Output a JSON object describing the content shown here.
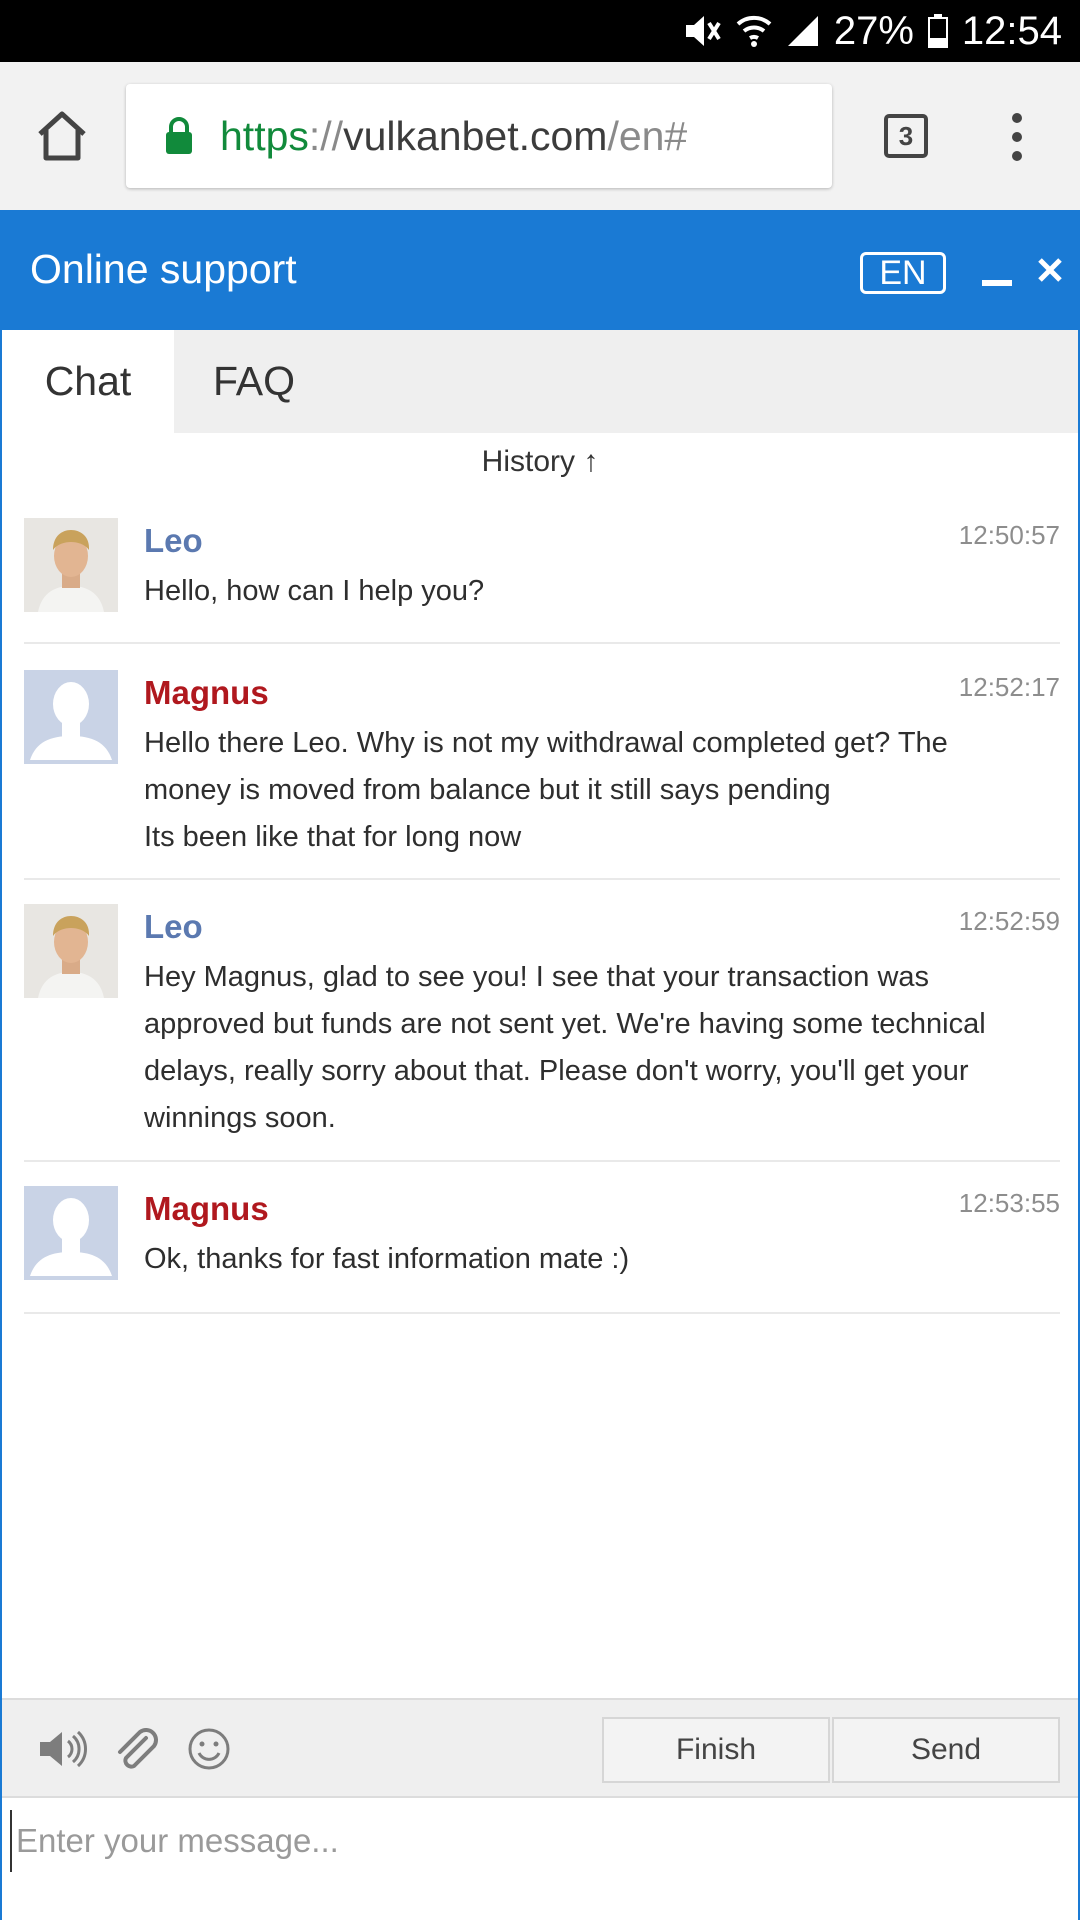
{
  "status_bar": {
    "battery": "27%",
    "time": "12:54"
  },
  "browser": {
    "url_scheme": "https",
    "url_sep": "://",
    "url_host": "vulkanbet.com",
    "url_path": "/en#",
    "tab_count": "3"
  },
  "widget": {
    "title": "Online support",
    "language": "EN",
    "tabs": [
      "Chat",
      "FAQ"
    ],
    "history_label": "History ↑",
    "messages": [
      {
        "sender": "Leo",
        "role": "agent",
        "time": "12:50:57",
        "text": "Hello, how can I help you?"
      },
      {
        "sender": "Magnus",
        "role": "user",
        "time": "12:52:17",
        "text": "Hello there Leo. Why is not my withdrawal completed get? The money is moved from balance but it still says pending\nIts been like that for long now"
      },
      {
        "sender": "Leo",
        "role": "agent",
        "time": "12:52:59",
        "text": "Hey Magnus, glad to see you! I see that your transaction was approved but funds are not sent yet. We're having some technical delays, really sorry about that. Please don't worry, you'll get your winnings soon."
      },
      {
        "sender": "Magnus",
        "role": "user",
        "time": "12:53:55",
        "text": "Ok, thanks for fast information mate :)"
      }
    ],
    "finish_label": "Finish",
    "send_label": "Send",
    "input_placeholder": "Enter your message..."
  },
  "colors": {
    "accent": "#1a7ad4",
    "agent_name": "#5b79b0",
    "user_name": "#b0181e",
    "secure_green": "#118a3b"
  },
  "icons": [
    "mute-icon",
    "wifi-icon",
    "signal-icon",
    "battery-icon",
    "home-icon",
    "lock-icon",
    "tabs-icon",
    "overflow-menu-icon",
    "minimize-icon",
    "close-icon",
    "speaker-icon",
    "paperclip-icon",
    "smiley-icon"
  ]
}
